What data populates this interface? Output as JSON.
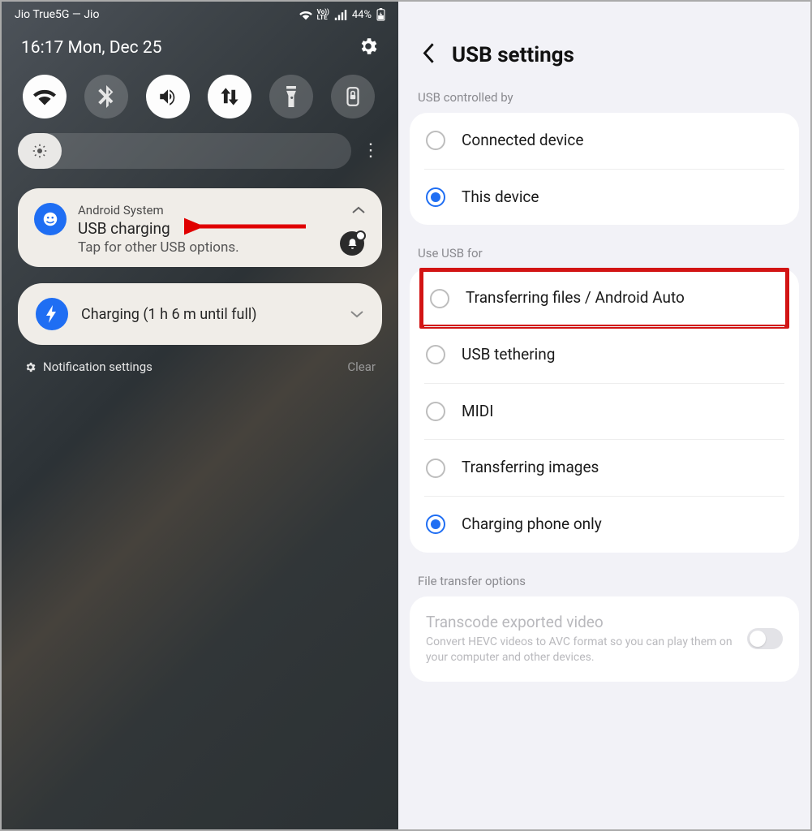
{
  "statusbar": {
    "carrier": "Jio True5G — Jio",
    "battery_pct": "44%"
  },
  "qs": {
    "time_date": "16:17  Mon, Dec 25"
  },
  "notif": {
    "app": "Android System",
    "title": "USB charging",
    "sub": "Tap for other USB options."
  },
  "charging": {
    "text": "Charging (1 h 6 m until full)"
  },
  "footer": {
    "settings": "Notification settings",
    "clear": "Clear"
  },
  "usb": {
    "title": "USB settings",
    "section_controlled": "USB controlled by",
    "opt_connected": "Connected device",
    "opt_this": "This device",
    "section_usefor": "Use USB for",
    "opt_transfer": "Transferring files / Android Auto",
    "opt_tether": "USB tethering",
    "opt_midi": "MIDI",
    "opt_images": "Transferring images",
    "opt_charging": "Charging phone only",
    "section_fileopt": "File transfer options",
    "file_title": "Transcode exported video",
    "file_sub": "Convert HEVC videos to AVC format so you can play them on your computer and other devices."
  }
}
